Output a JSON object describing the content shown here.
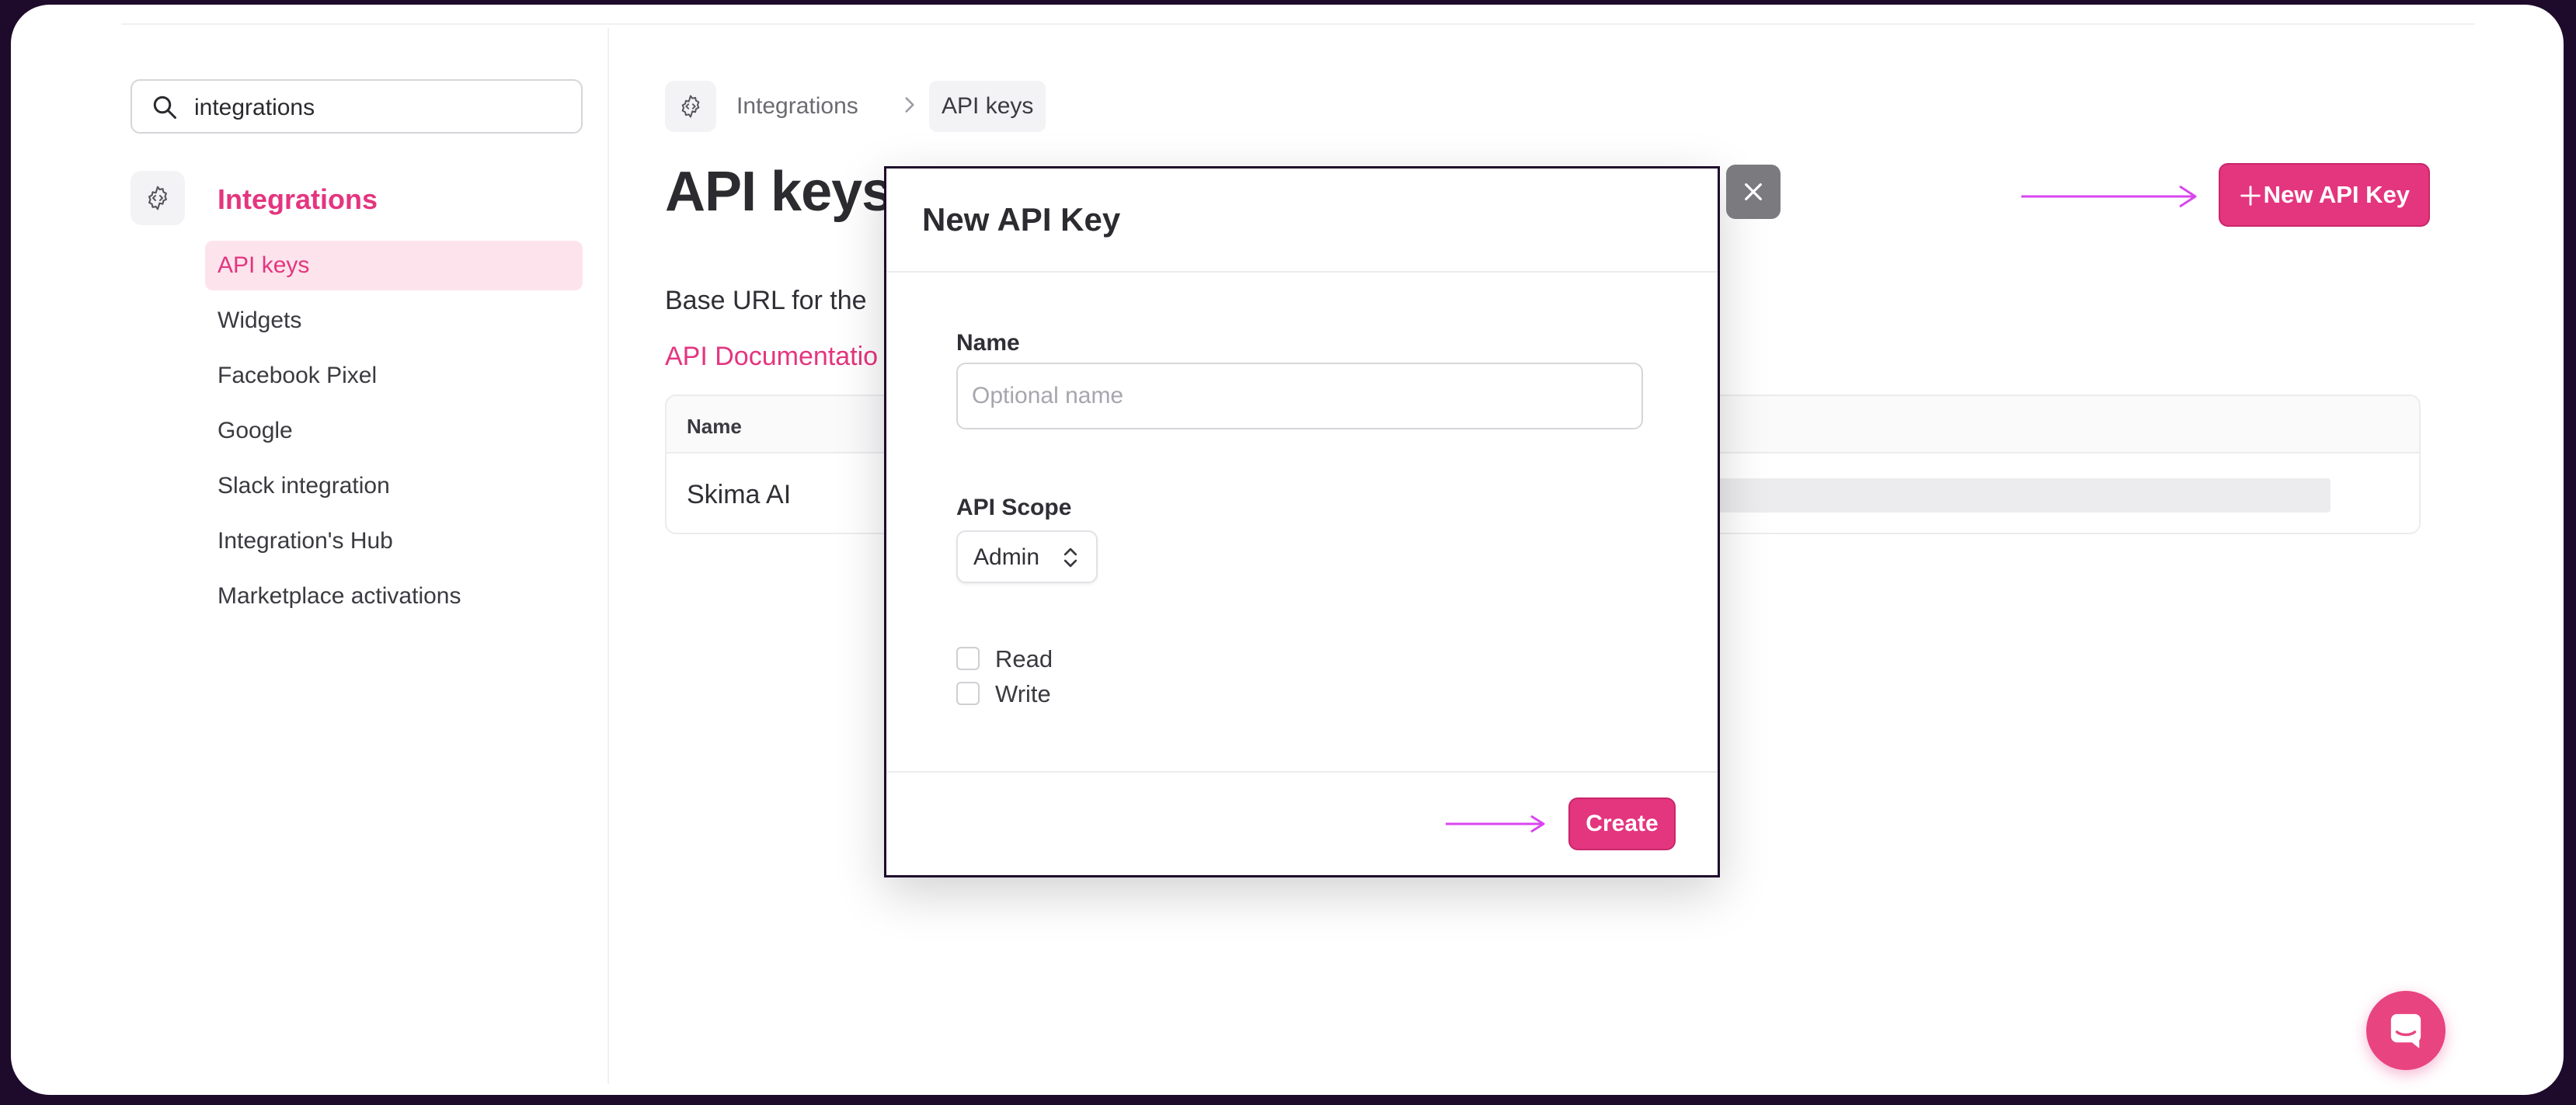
{
  "sidebar": {
    "search_value": "integrations",
    "group_title": "Integrations",
    "items": [
      {
        "label": "API keys",
        "active": true
      },
      {
        "label": "Widgets"
      },
      {
        "label": "Facebook Pixel"
      },
      {
        "label": "Google"
      },
      {
        "label": "Slack integration"
      },
      {
        "label": "Integration's Hub"
      },
      {
        "label": "Marketplace activations"
      }
    ]
  },
  "breadcrumb": {
    "parent": "Integrations",
    "current": "API keys"
  },
  "main": {
    "title": "API keys",
    "base_url_text": "Base URL for the",
    "doc_link": "API Documentatio",
    "new_key_button": "New API Key",
    "table": {
      "headers": [
        "Name"
      ],
      "rows": [
        {
          "name": "Skima AI"
        }
      ]
    }
  },
  "modal": {
    "title": "New API Key",
    "name_label": "Name",
    "name_placeholder": "Optional name",
    "scope_label": "API Scope",
    "scope_value": "Admin",
    "checkboxes": [
      "Read",
      "Write"
    ],
    "create_button": "Create"
  },
  "colors": {
    "accent": "#e4357f",
    "annotation_arrow": "#d946ef"
  },
  "icons": [
    "search-icon",
    "integrations-gear-icon",
    "chevron-right-icon",
    "plus-icon",
    "close-icon",
    "select-chevron-icon",
    "chat-icon"
  ]
}
